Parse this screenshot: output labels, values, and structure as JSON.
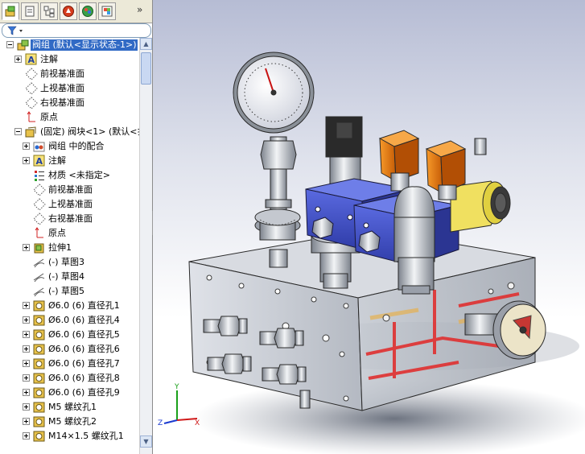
{
  "manager_tabs": [
    {
      "icon": "feature-manager-icon",
      "active": true
    },
    {
      "icon": "property-manager-icon",
      "active": false
    },
    {
      "icon": "configuration-manager-icon",
      "active": false
    },
    {
      "icon": "dimxpert-manager-icon",
      "active": false
    },
    {
      "icon": "display-manager-icon",
      "active": false
    },
    {
      "icon": "render-manager-icon",
      "active": false
    }
  ],
  "more_tabs": "»",
  "filter_icon": "filter-icon",
  "tree": [
    {
      "level": 0,
      "expander": "minus",
      "icon": "assembly-icon",
      "label": "阀组 (默认<显示状态-1>)",
      "selected": true
    },
    {
      "level": 1,
      "expander": "plus",
      "icon": "annotation-icon",
      "label": "注解"
    },
    {
      "level": 1,
      "expander": "none",
      "icon": "plane-icon",
      "label": "前视基准面"
    },
    {
      "level": 1,
      "expander": "none",
      "icon": "plane-icon",
      "label": "上视基准面"
    },
    {
      "level": 1,
      "expander": "none",
      "icon": "plane-icon",
      "label": "右视基准面"
    },
    {
      "level": 1,
      "expander": "none",
      "icon": "origin-icon",
      "label": "原点"
    },
    {
      "level": 1,
      "expander": "minus",
      "icon": "part-icon",
      "label": "(固定) 阀块<1> (默认<扌"
    },
    {
      "level": 2,
      "expander": "plus",
      "icon": "mates-icon",
      "label": "阀组 中的配合"
    },
    {
      "level": 2,
      "expander": "plus",
      "icon": "annotation-icon",
      "label": "注解"
    },
    {
      "level": 2,
      "expander": "none",
      "icon": "material-icon",
      "label": "材质 <未指定>"
    },
    {
      "level": 2,
      "expander": "none",
      "icon": "plane-icon",
      "label": "前视基准面"
    },
    {
      "level": 2,
      "expander": "none",
      "icon": "plane-icon",
      "label": "上视基准面"
    },
    {
      "level": 2,
      "expander": "none",
      "icon": "plane-icon",
      "label": "右视基准面"
    },
    {
      "level": 2,
      "expander": "none",
      "icon": "origin-icon",
      "label": "原点"
    },
    {
      "level": 2,
      "expander": "plus",
      "icon": "extrude-icon",
      "label": "拉伸1"
    },
    {
      "level": 2,
      "expander": "none",
      "icon": "sketch-icon",
      "label": "(-) 草图3"
    },
    {
      "level": 2,
      "expander": "none",
      "icon": "sketch-icon",
      "label": "(-) 草图4"
    },
    {
      "level": 2,
      "expander": "none",
      "icon": "sketch-icon",
      "label": "(-) 草图5"
    },
    {
      "level": 2,
      "expander": "plus",
      "icon": "hole-icon",
      "label": "Ø6.0 (6) 直径孔1"
    },
    {
      "level": 2,
      "expander": "plus",
      "icon": "hole-icon",
      "label": "Ø6.0 (6) 直径孔4"
    },
    {
      "level": 2,
      "expander": "plus",
      "icon": "hole-icon",
      "label": "Ø6.0 (6) 直径孔5"
    },
    {
      "level": 2,
      "expander": "plus",
      "icon": "hole-icon",
      "label": "Ø6.0 (6) 直径孔6"
    },
    {
      "level": 2,
      "expander": "plus",
      "icon": "hole-icon",
      "label": "Ø6.0 (6) 直径孔7"
    },
    {
      "level": 2,
      "expander": "plus",
      "icon": "hole-icon",
      "label": "Ø6.0 (6) 直径孔8"
    },
    {
      "level": 2,
      "expander": "plus",
      "icon": "hole-icon",
      "label": "Ø6.0 (6) 直径孔9"
    },
    {
      "level": 2,
      "expander": "plus",
      "icon": "hole-icon",
      "label": "M5 螺纹孔1"
    },
    {
      "level": 2,
      "expander": "plus",
      "icon": "hole-icon",
      "label": "M5 螺纹孔2"
    },
    {
      "level": 2,
      "expander": "plus",
      "icon": "hole-icon",
      "label": "M14×1.5 螺纹孔1"
    }
  ],
  "colors": {
    "selection": "#316ac5",
    "manifold": "#c8ccd2",
    "valve_blue": "#3f4fc4",
    "solenoid_orange": "#e8780c",
    "coil_yellow": "#f0e060",
    "internal_passage": "#e03030"
  },
  "triad": {
    "x_label": "X",
    "y_label": "Y",
    "z_label": "Z"
  }
}
